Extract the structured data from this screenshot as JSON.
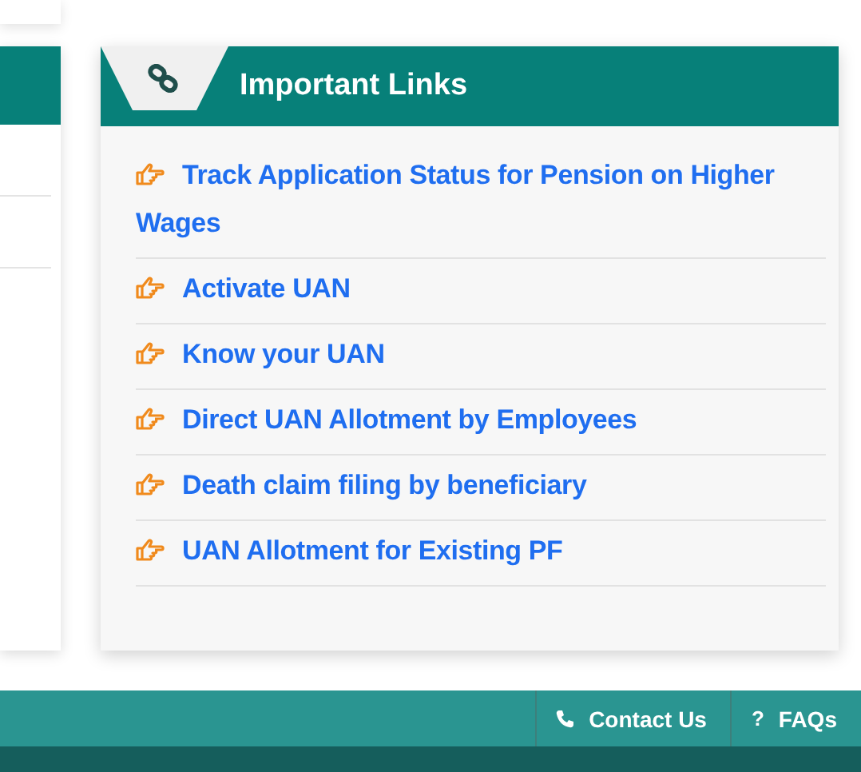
{
  "panel": {
    "title": "Important Links"
  },
  "links": [
    {
      "label": "Track Application Status for Pension on Higher Wages"
    },
    {
      "label": "Activate UAN"
    },
    {
      "label": "Know your UAN"
    },
    {
      "label": "Direct UAN Allotment by Employees"
    },
    {
      "label": "Death claim filing by beneficiary"
    },
    {
      "label": "UAN Allotment for Existing PF"
    }
  ],
  "footer_links": [
    {
      "kind": "phone",
      "label": "Contact Us"
    },
    {
      "kind": "glyph",
      "glyph": "?",
      "label": "FAQs"
    }
  ]
}
